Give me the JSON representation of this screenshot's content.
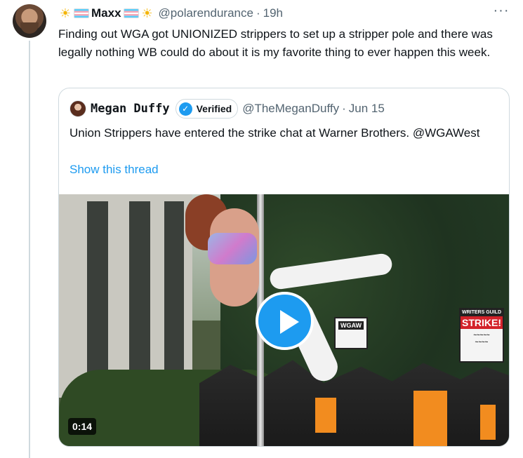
{
  "tweet": {
    "author": {
      "prefix_emoji": "sun-icon",
      "flag": "trans-flag-icon",
      "display_name": "Maxx",
      "suffix_emoji": "sun-icon",
      "handle": "@polarendurance",
      "separator": "·",
      "time": "19h"
    },
    "more_label": "···",
    "text": "Finding out WGA got UNIONIZED strippers to set up a stripper pole and there was legally nothing WB could do about it is my favorite thing to ever happen this week."
  },
  "quote": {
    "author": {
      "display_name": "Megan Duffy",
      "verified_label": "Verified",
      "handle": "@TheMeganDuffy",
      "separator": "·",
      "date": "Jun 15"
    },
    "text": "Union Strippers have entered the strike chat at Warner Brothers. @WGAWest",
    "show_thread": "Show this thread",
    "media": {
      "type": "video",
      "duration": "0:14",
      "signs": {
        "strike_header": "WRITERS GUILD",
        "strike_main": "STRIKE!",
        "wga_sign": "WGAW"
      }
    }
  },
  "colors": {
    "accent": "#1d9bf0",
    "text": "#0f1419",
    "secondary": "#536471",
    "border": "#cfd9de"
  }
}
